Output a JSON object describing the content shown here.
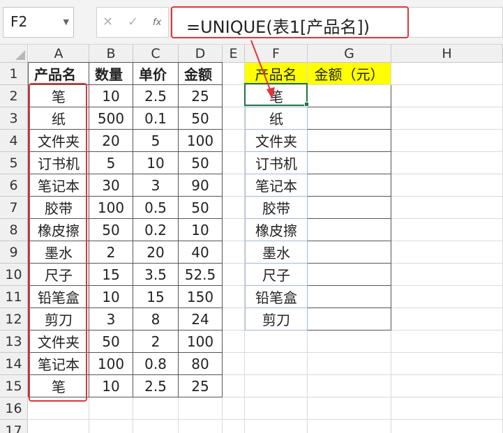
{
  "name_box": {
    "value": "F2"
  },
  "formula_bar": {
    "cancel_icon": "cancel-icon",
    "enter_icon": "enter-icon",
    "fx_label": "fx",
    "formula": "=UNIQUE(表1[产品名])"
  },
  "columns": [
    "A",
    "B",
    "C",
    "D",
    "E",
    "F",
    "G",
    "H"
  ],
  "rows": [
    "1",
    "2",
    "3",
    "4",
    "5",
    "6",
    "7",
    "8",
    "9",
    "10",
    "11",
    "12",
    "13",
    "14",
    "15",
    "16",
    "17"
  ],
  "table": {
    "headers": [
      "产品名",
      "数量",
      "单价",
      "金额"
    ],
    "rows": [
      [
        "笔",
        "10",
        "2.5",
        "25"
      ],
      [
        "纸",
        "500",
        "0.1",
        "50"
      ],
      [
        "文件夹",
        "20",
        "5",
        "100"
      ],
      [
        "订书机",
        "5",
        "10",
        "50"
      ],
      [
        "笔记本",
        "30",
        "3",
        "90"
      ],
      [
        "胶带",
        "100",
        "0.5",
        "50"
      ],
      [
        "橡皮擦",
        "50",
        "0.2",
        "10"
      ],
      [
        "墨水",
        "2",
        "20",
        "40"
      ],
      [
        "尺子",
        "15",
        "3.5",
        "52.5"
      ],
      [
        "铅笔盒",
        "10",
        "15",
        "150"
      ],
      [
        "剪刀",
        "3",
        "8",
        "24"
      ],
      [
        "文件夹",
        "50",
        "2",
        "100"
      ],
      [
        "笔记本",
        "100",
        "0.8",
        "80"
      ],
      [
        "笔",
        "10",
        "2.5",
        "25"
      ]
    ]
  },
  "summary": {
    "header_product": "产品名",
    "header_amount": "金额（元）",
    "products": [
      "笔",
      "纸",
      "文件夹",
      "订书机",
      "笔记本",
      "胶带",
      "橡皮擦",
      "墨水",
      "尺子",
      "铅笔盒",
      "剪刀"
    ]
  },
  "colors": {
    "highlight_red": "#e0353a",
    "header_yellow": "#ffff00",
    "active_green": "#217346"
  }
}
